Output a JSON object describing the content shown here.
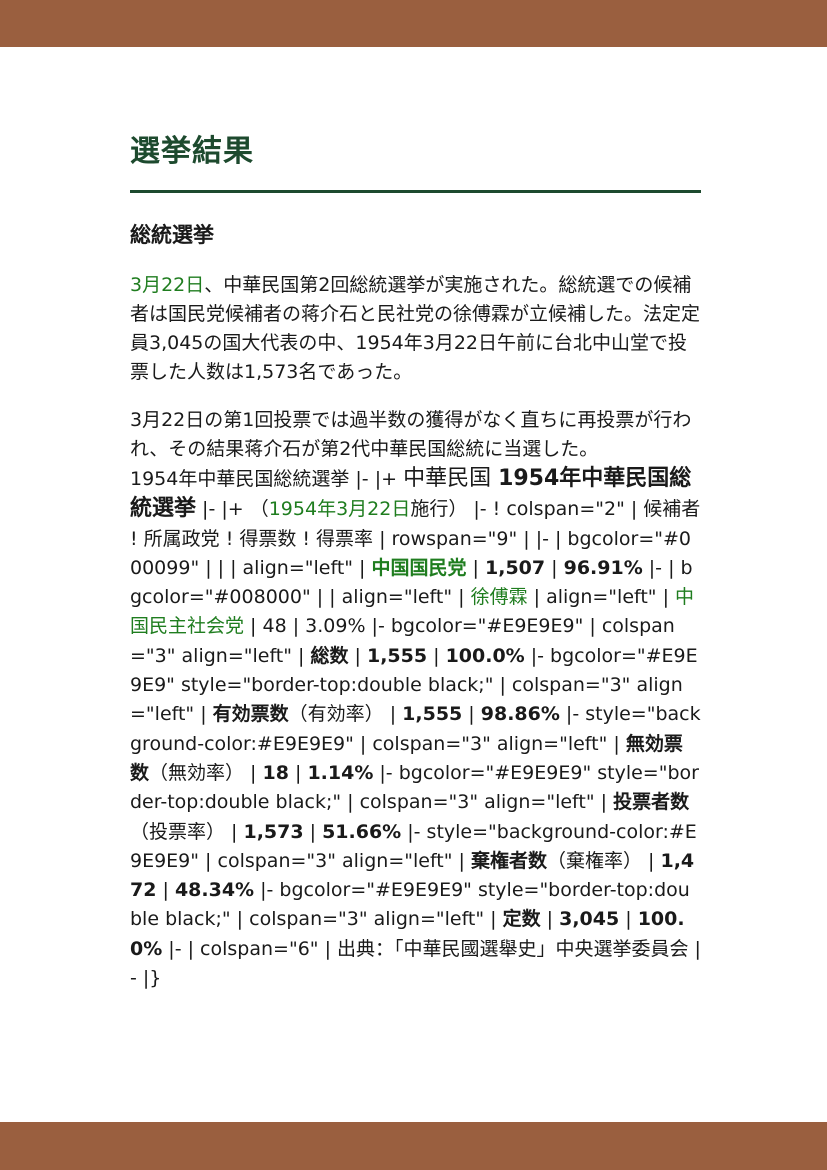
{
  "header": {
    "title": "選挙結果",
    "subtitle": "総統選挙"
  },
  "para1": {
    "link": "3月22日",
    "text": "、中華民国第2回総統選挙が実施された。総統選での候補者は国民党候補者の蒋介石と民社党の徐傅霖が立候補した。法定定員3,045の国大代表の中、1954年3月22日午前に台北中山堂で投票した人数は1,573名であった。"
  },
  "para2": {
    "text": "3月22日の第1回投票では過半数の獲得がなく直ちに再投票が行われ、その結果蒋介石が第2代中華民国総統に当選した。"
  },
  "wiki": {
    "s1": "1954年中華民国総統選挙 |- |+ ",
    "s2": "中華民国 ",
    "s3": "1954年中華民国総統選挙",
    "s4": " |- |+ （",
    "s5": "1954年3月22日",
    "s6": "施行） |- ! colspan=\"2\" | 候補者 ! 所属政党 ! 得票数 ! 得票率 | rowspan=\"9\" | |- | bgcolor=\"#000099\" | | | align=\"left\" | ",
    "s7": "中国国民党",
    "s8": " | ",
    "s9": "1,507",
    "s10": " | ",
    "s11": "96.91%",
    "s12": " |- | bgcolor=\"#008000\" | | align=\"left\" | ",
    "s13": "徐傅霖",
    "s14": " | align=\"left\" | ",
    "s15": "中国民主社会党",
    "s16": " | 48 | 3.09% |- bgcolor=\"#E9E9E9\" | colspan=\"3\" align=\"left\" | ",
    "s17": "総数",
    "s18": " | ",
    "s19": "1,555",
    "s20": " | ",
    "s21": "100.0%",
    "s22": " |- bgcolor=\"#E9E9E9\" style=\"border-top:double black;\" | colspan=\"3\" align=\"left\" | ",
    "s23": "有効票数",
    "s24": "（有効率） | ",
    "s25": "1,555",
    "s26": " | ",
    "s27": "98.86%",
    "s28": " |- style=\"background-color:#E9E9E9\" | colspan=\"3\" align=\"left\" | ",
    "s29": "無効票数",
    "s30": "（無効率） | ",
    "s31": "18",
    "s32": " | ",
    "s33": "1.14%",
    "s34": " |- bgcolor=\"#E9E9E9\" style=\"border-top:double black;\" | colspan=\"3\" align=\"left\" | ",
    "s35": "投票者数",
    "s36": "（投票率） | ",
    "s37": "1,573",
    "s38": " | ",
    "s39": "51.66%",
    "s40": " |- style=\"background-color:#E9E9E9\" | colspan=\"3\" align=\"left\" | ",
    "s41": "棄権者数",
    "s42": "（棄権率） | ",
    "s43": "1,472",
    "s44": " | ",
    "s45": "48.34%",
    "s46": " |- bgcolor=\"#E9E9E9\" style=\"border-top:double black;\" | colspan=\"3\" align=\"left\" | ",
    "s47": "定数",
    "s48": " | ",
    "s49": "3,045",
    "s50": " | ",
    "s51": "100.0%",
    "s52": " |- | colspan=\"6\" | 出典：「中華民國選舉史」中央選挙委員会 |- |}"
  },
  "colors": {
    "band": "#9a5f3f",
    "heading": "#1d4a2e",
    "link": "#1f7d1f"
  }
}
